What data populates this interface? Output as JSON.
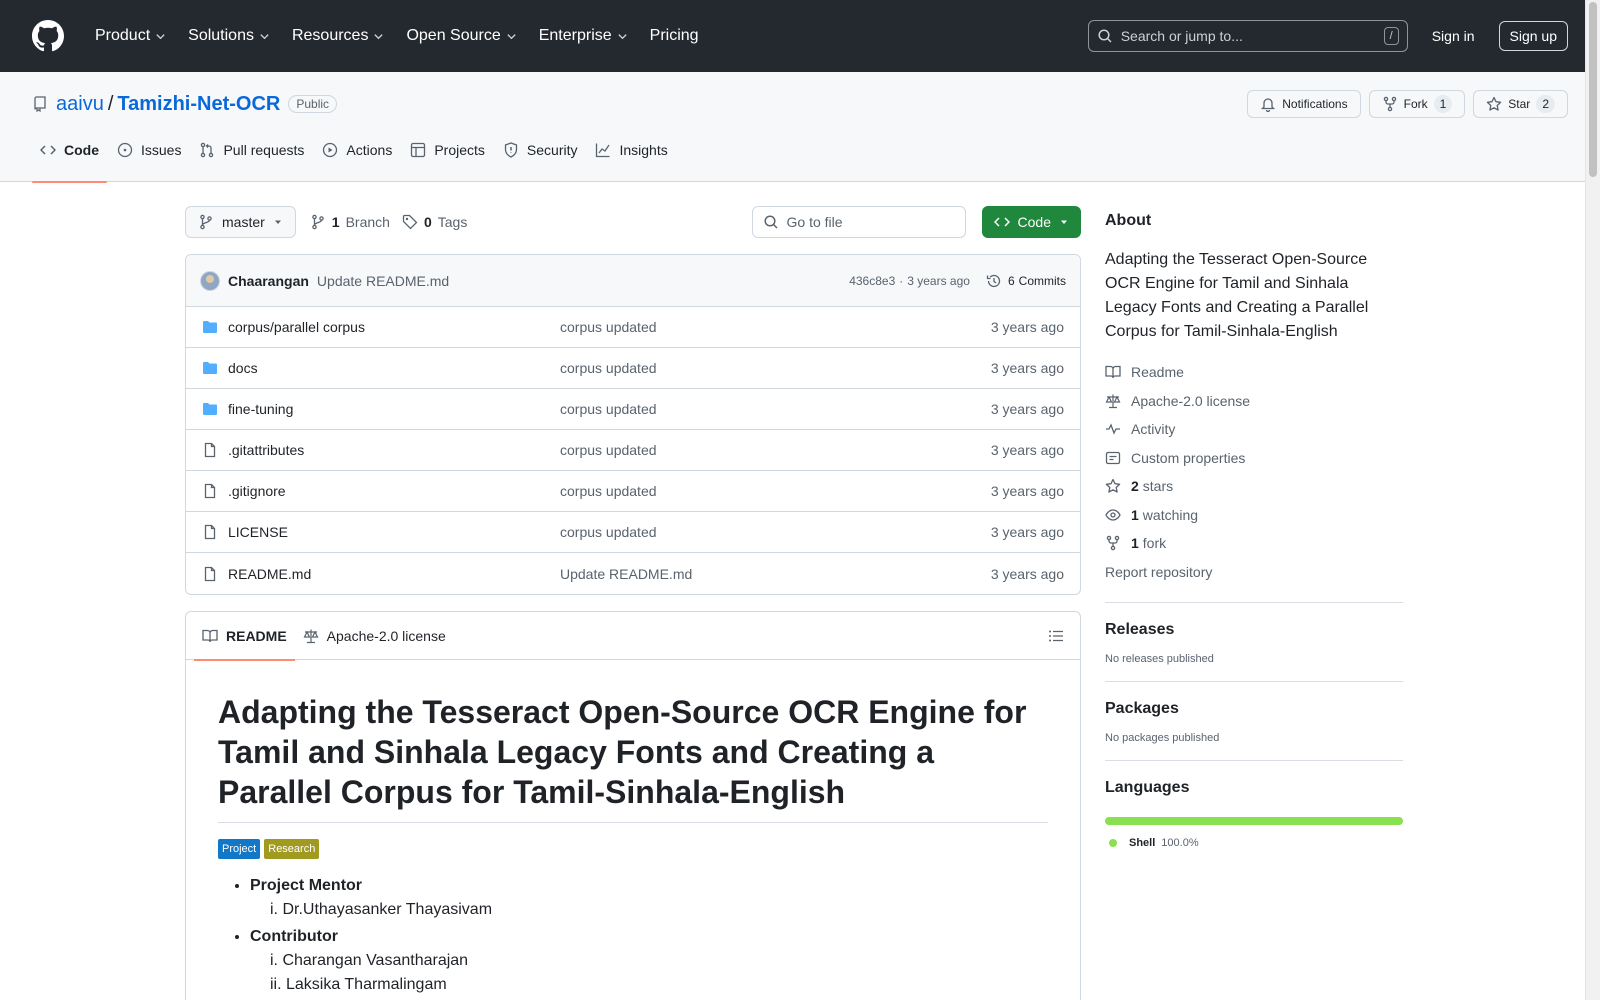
{
  "nav": {
    "items": [
      "Product",
      "Solutions",
      "Resources",
      "Open Source",
      "Enterprise",
      "Pricing"
    ],
    "search_placeholder": "Search or jump to...",
    "search_shortcut": "/",
    "sign_in": "Sign in",
    "sign_up": "Sign up"
  },
  "repo": {
    "owner": "aaivu",
    "slash": "/",
    "name": "Tamizhi-Net-OCR",
    "visibility": "Public",
    "notifications_label": "Notifications",
    "fork_label": "Fork",
    "fork_count": "1",
    "star_label": "Star",
    "star_count": "2",
    "tabs": [
      "Code",
      "Issues",
      "Pull requests",
      "Actions",
      "Projects",
      "Security",
      "Insights"
    ]
  },
  "filenav": {
    "branch": "master",
    "branch_count": "1",
    "branch_label": "Branch",
    "tag_count": "0",
    "tag_label": "Tags",
    "goto_placeholder": "Go to file",
    "code_button": "Code"
  },
  "commit": {
    "author": "Chaarangan",
    "message": "Update README.md",
    "hash": "436c8e3",
    "separator": "·",
    "time": "3 years ago",
    "commits_count": "6",
    "commits_label": "Commits"
  },
  "files": [
    {
      "name": "corpus/parallel corpus",
      "type": "dir",
      "message": "corpus updated",
      "date": "3 years ago"
    },
    {
      "name": "docs",
      "type": "dir",
      "message": "corpus updated",
      "date": "3 years ago"
    },
    {
      "name": "fine-tuning",
      "type": "dir",
      "message": "corpus updated",
      "date": "3 years ago"
    },
    {
      "name": ".gitattributes",
      "type": "file",
      "message": "corpus updated",
      "date": "3 years ago"
    },
    {
      "name": ".gitignore",
      "type": "file",
      "message": "corpus updated",
      "date": "3 years ago"
    },
    {
      "name": "LICENSE",
      "type": "file",
      "message": "corpus updated",
      "date": "3 years ago"
    },
    {
      "name": "README.md",
      "type": "file",
      "message": "Update README.md",
      "date": "3 years ago"
    }
  ],
  "readme": {
    "tab_readme": "README",
    "tab_license": "Apache-2.0 license",
    "title": "Adapting the Tesseract Open-Source OCR Engine for Tamil and Sinhala Legacy Fonts and Creating a Parallel Corpus for Tamil-Sinhala-English",
    "badges": [
      {
        "label": "Project",
        "color": "#1177c6"
      },
      {
        "label": "Research",
        "color": "#a19a21"
      }
    ],
    "mentor_heading": "Project Mentor",
    "mentors": [
      "i. Dr.Uthayasanker Thayasivam"
    ],
    "contributor_heading": "Contributor",
    "contributors": [
      "i. Charangan Vasantharajan",
      "ii. Laksika Tharmalingam"
    ]
  },
  "about": {
    "title": "About",
    "description": "Adapting the Tesseract Open-Source OCR Engine for Tamil and Sinhala Legacy Fonts and Creating a Parallel Corpus for Tamil-Sinhala-English",
    "readme": "Readme",
    "license": "Apache-2.0 license",
    "activity": "Activity",
    "custom_properties": "Custom properties",
    "stars_count": "2",
    "stars_label": "stars",
    "watching_count": "1",
    "watching_label": "watching",
    "forks_count": "1",
    "forks_label": "fork",
    "report": "Report repository"
  },
  "releases": {
    "title": "Releases",
    "text": "No releases published"
  },
  "packages": {
    "title": "Packages",
    "text": "No packages published"
  },
  "languages": {
    "title": "Languages",
    "items": [
      {
        "name": "Shell",
        "percent": "100.0%",
        "color": "#89e051"
      }
    ]
  },
  "colors": {
    "header_bg": "#24292f",
    "link": "#0969da",
    "code_button": "#1f883d",
    "active_tab_underline": "#fd8c73",
    "folder_icon": "#54aeff"
  }
}
